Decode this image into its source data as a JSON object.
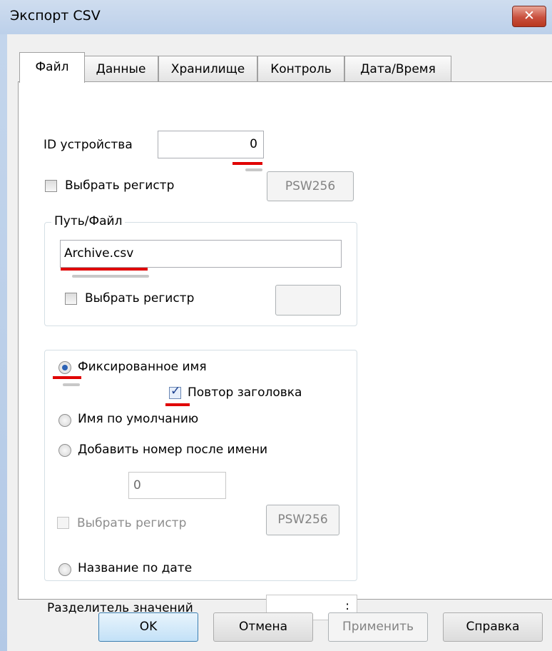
{
  "window": {
    "title": "Экспорт CSV",
    "close_glyph": "✕"
  },
  "tabs": [
    "Файл",
    "Данные",
    "Хранилище",
    "Контроль",
    "Дата/Время"
  ],
  "active_tab": "Файл",
  "device": {
    "label": "ID устройства",
    "value": "0"
  },
  "select_register_top": {
    "label": "Выбрать регистр",
    "checked": false,
    "button": "PSW256"
  },
  "path_group": {
    "title": "Путь/Файл",
    "file": "Archive.csv",
    "select_register": {
      "label": "Выбрать регистр",
      "checked": false,
      "button": ""
    }
  },
  "naming": {
    "fixed": {
      "label": "Фиксированное имя",
      "selected": true
    },
    "repeat_header": {
      "label": "Повтор заголовка",
      "checked": true
    },
    "default": {
      "label": "Имя по умолчанию",
      "selected": false
    },
    "add_number": {
      "label": "Добавить номер после имени",
      "selected": false
    },
    "number_value": "0",
    "select_register": {
      "label": "Выбрать регистр",
      "checked": false,
      "button": "PSW256",
      "enabled": false
    },
    "date_name": {
      "label": "Название по дате",
      "selected": false
    }
  },
  "separator": {
    "label": "Разделитель значений",
    "value": ":"
  },
  "buttons": {
    "ok": "OK",
    "cancel": "Отмена",
    "apply": "Применить",
    "help": "Справка"
  },
  "colors": {
    "accent_red": "#e00000",
    "title_bar": "#c4d6ec",
    "close_red": "#c9503e"
  }
}
